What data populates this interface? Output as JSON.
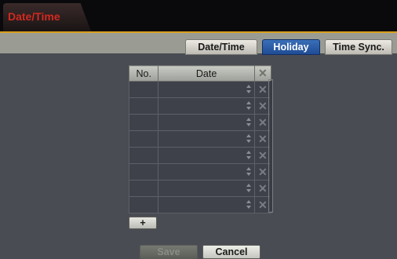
{
  "window": {
    "title": "Date/Time"
  },
  "tabs": [
    {
      "label": "Date/Time",
      "active": false
    },
    {
      "label": "Holiday",
      "active": true
    },
    {
      "label": "Time Sync.",
      "active": false
    }
  ],
  "table": {
    "headers": {
      "no": "No.",
      "date": "Date",
      "delete": "✕"
    },
    "rows": [
      {
        "no": "",
        "date": "",
        "delete": "✕"
      },
      {
        "no": "",
        "date": "",
        "delete": "✕"
      },
      {
        "no": "",
        "date": "",
        "delete": "✕"
      },
      {
        "no": "",
        "date": "",
        "delete": "✕"
      },
      {
        "no": "",
        "date": "",
        "delete": "✕"
      },
      {
        "no": "",
        "date": "",
        "delete": "✕"
      },
      {
        "no": "",
        "date": "",
        "delete": "✕"
      },
      {
        "no": "",
        "date": "",
        "delete": "✕"
      }
    ]
  },
  "buttons": {
    "add": "+",
    "save": "Save",
    "cancel": "Cancel"
  },
  "colors": {
    "title_text": "#d22a20",
    "accent_line": "#d8a01c",
    "active_tab": "#1f4c95"
  }
}
